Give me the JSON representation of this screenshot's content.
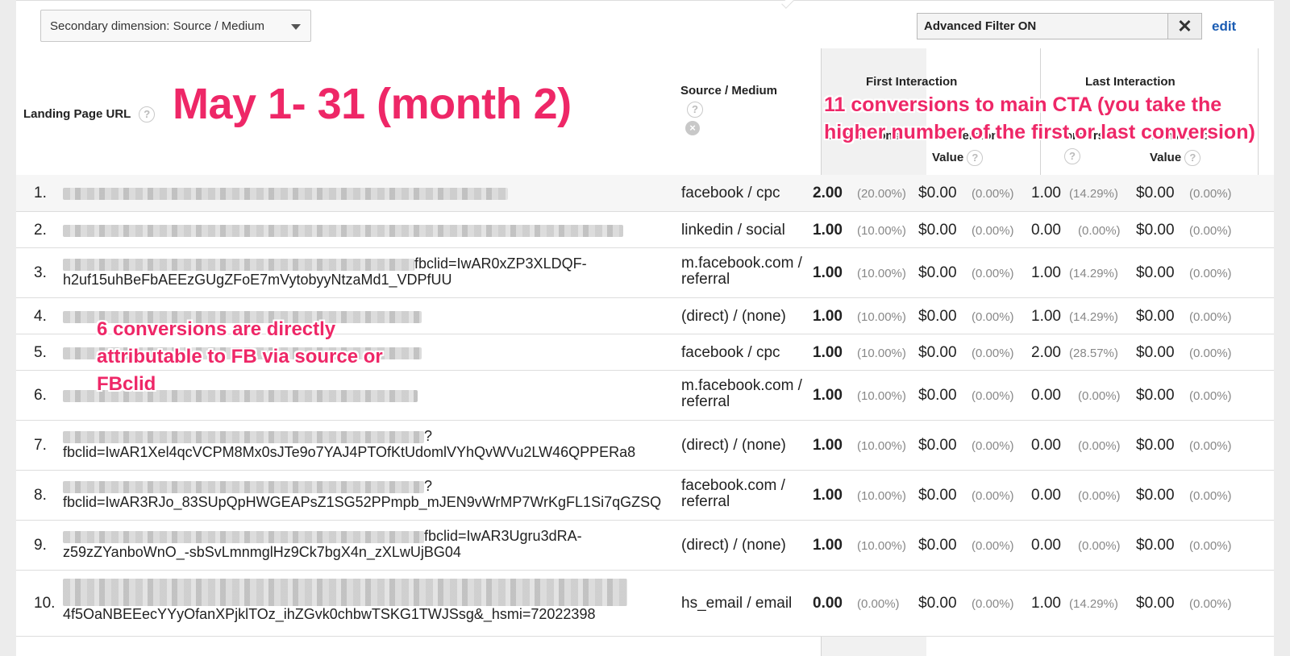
{
  "toolbar": {
    "secondary_dimension": "Secondary dimension: Source / Medium",
    "filter_value": "Advanced Filter ON",
    "edit_label": "edit"
  },
  "headers": {
    "landing_page": "Landing Page URL",
    "source_medium": "Source / Medium",
    "first_interaction": "First Interaction",
    "last_interaction": "Last Interaction",
    "conversions": "Conversions",
    "conversion_value": "Conversion Value",
    "conversion_label": "Conversion",
    "value_label": "Value"
  },
  "annotations": {
    "title": "May 1- 31 (month 2)",
    "right_note": "11 conversions to main CTA (you take the higher number of the first or last conversion)",
    "left_note": "6 conversions are directly attributable to FB via source or FBclid"
  },
  "rows": [
    {
      "idx": "1.",
      "url_line1": "",
      "url_line2": "",
      "source": "facebook / cpc",
      "fi_conv": "2.00",
      "fi_conv_pct": "(20.00%)",
      "fi_val": "$0.00",
      "fi_val_pct": "(0.00%)",
      "li_conv": "1.00",
      "li_conv_pct": "(14.29%)",
      "li_val": "$0.00",
      "li_val_pct": "(0.00%)"
    },
    {
      "idx": "2.",
      "url_line1": "",
      "url_line2": "",
      "source": "linkedin / social",
      "fi_conv": "1.00",
      "fi_conv_pct": "(10.00%)",
      "fi_val": "$0.00",
      "fi_val_pct": "(0.00%)",
      "li_conv": "0.00",
      "li_conv_pct": "(0.00%)",
      "li_val": "$0.00",
      "li_val_pct": "(0.00%)"
    },
    {
      "idx": "3.",
      "url_line1": "fbclid=IwAR0xZP3XLDQF-",
      "url_line2": "h2uf15uhBeFbAEEzGUgZFoE7mVytobyyNtzaMd1_VDPfUU",
      "source": "m.facebook.com / referral",
      "fi_conv": "1.00",
      "fi_conv_pct": "(10.00%)",
      "fi_val": "$0.00",
      "fi_val_pct": "(0.00%)",
      "li_conv": "1.00",
      "li_conv_pct": "(14.29%)",
      "li_val": "$0.00",
      "li_val_pct": "(0.00%)"
    },
    {
      "idx": "4.",
      "url_line1": "",
      "url_line2": "",
      "source": "(direct) / (none)",
      "fi_conv": "1.00",
      "fi_conv_pct": "(10.00%)",
      "fi_val": "$0.00",
      "fi_val_pct": "(0.00%)",
      "li_conv": "1.00",
      "li_conv_pct": "(14.29%)",
      "li_val": "$0.00",
      "li_val_pct": "(0.00%)"
    },
    {
      "idx": "5.",
      "url_line1": "",
      "url_line2": "",
      "source": "facebook / cpc",
      "fi_conv": "1.00",
      "fi_conv_pct": "(10.00%)",
      "fi_val": "$0.00",
      "fi_val_pct": "(0.00%)",
      "li_conv": "2.00",
      "li_conv_pct": "(28.57%)",
      "li_val": "$0.00",
      "li_val_pct": "(0.00%)"
    },
    {
      "idx": "6.",
      "url_line1": "",
      "url_line2": "",
      "source": "m.facebook.com / referral",
      "fi_conv": "1.00",
      "fi_conv_pct": "(10.00%)",
      "fi_val": "$0.00",
      "fi_val_pct": "(0.00%)",
      "li_conv": "0.00",
      "li_conv_pct": "(0.00%)",
      "li_val": "$0.00",
      "li_val_pct": "(0.00%)"
    },
    {
      "idx": "7.",
      "url_line1": "?",
      "url_line2": "fbclid=IwAR1Xel4qcVCPM8Mx0sJTe9o7YAJ4PTOfKtUdomlVYhQvWVu2LW46QPPERa8",
      "source": "(direct) / (none)",
      "fi_conv": "1.00",
      "fi_conv_pct": "(10.00%)",
      "fi_val": "$0.00",
      "fi_val_pct": "(0.00%)",
      "li_conv": "0.00",
      "li_conv_pct": "(0.00%)",
      "li_val": "$0.00",
      "li_val_pct": "(0.00%)"
    },
    {
      "idx": "8.",
      "url_line1": "?",
      "url_line2": "fbclid=IwAR3RJo_83SUpQpHWGEAPsZ1SG52PPmpb_mJEN9vWrMP7WrKgFL1Si7qGZSQ",
      "source": "facebook.com / referral",
      "fi_conv": "1.00",
      "fi_conv_pct": "(10.00%)",
      "fi_val": "$0.00",
      "fi_val_pct": "(0.00%)",
      "li_conv": "0.00",
      "li_conv_pct": "(0.00%)",
      "li_val": "$0.00",
      "li_val_pct": "(0.00%)"
    },
    {
      "idx": "9.",
      "url_line1": "fbclid=IwAR3Ugru3dRA-",
      "url_line2": "z59zZYanboWnO_-sbSvLmnmglHz9Ck7bgX4n_zXLwUjBG04",
      "source": "(direct) / (none)",
      "fi_conv": "1.00",
      "fi_conv_pct": "(10.00%)",
      "fi_val": "$0.00",
      "fi_val_pct": "(0.00%)",
      "li_conv": "0.00",
      "li_conv_pct": "(0.00%)",
      "li_val": "$0.00",
      "li_val_pct": "(0.00%)"
    },
    {
      "idx": "10.",
      "url_line1": "",
      "url_line2": "4f5OaNBEEecYYyOfanXPjklTOz_ihZGvk0chbwTSKG1TWJSsg&_hsmi=72022398",
      "source": "hs_email / email",
      "fi_conv": "0.00",
      "fi_conv_pct": "(0.00%)",
      "fi_val": "$0.00",
      "fi_val_pct": "(0.00%)",
      "li_conv": "1.00",
      "li_conv_pct": "(14.29%)",
      "li_val": "$0.00",
      "li_val_pct": "(0.00%)"
    }
  ]
}
